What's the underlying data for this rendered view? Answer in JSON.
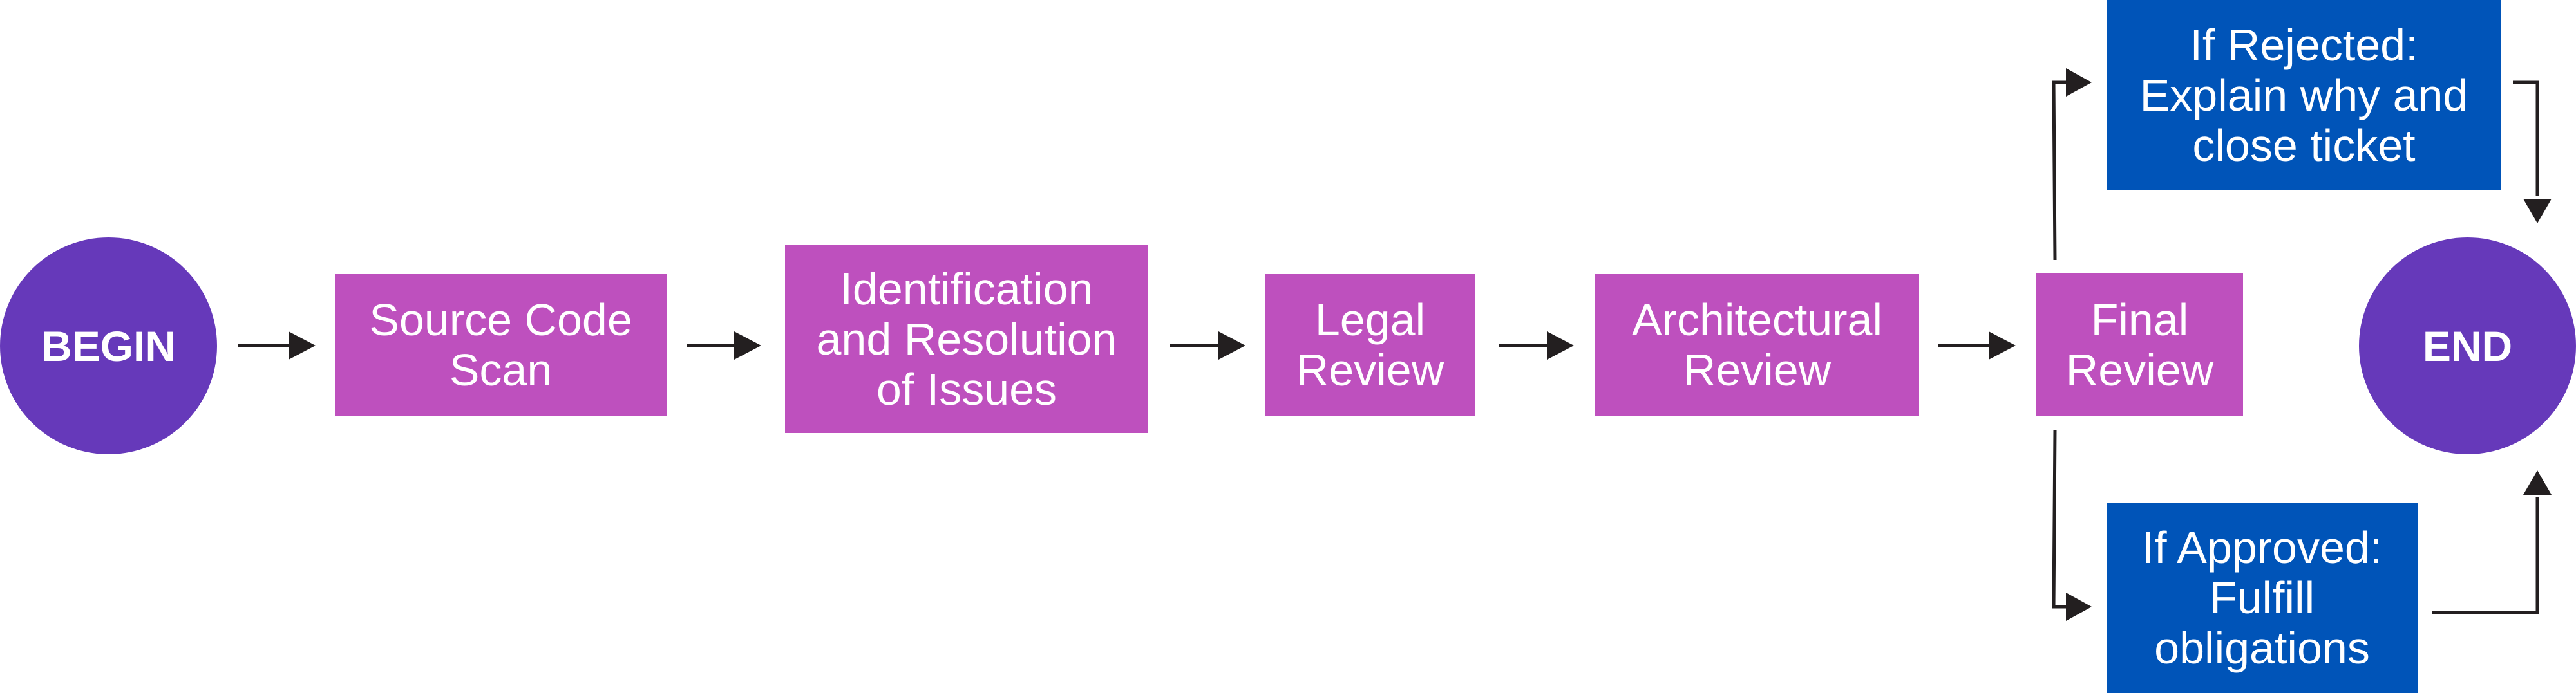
{
  "colors": {
    "terminal": "#6639BA",
    "step": "#BE50BE",
    "outcome": "#0054B8",
    "connector": "#231F20",
    "text": "#FFFFFF"
  },
  "nodes": {
    "begin": "BEGIN",
    "source_code_scan": "Source Code\nScan",
    "identification": "Identification\nand Resolution\nof Issues",
    "legal_review": "Legal\nReview",
    "architectural_review": "Architectural\nReview",
    "final_review": "Final\nReview",
    "rejected": "If Rejected:\nExplain why and\nclose ticket",
    "approved": "If Approved:\nFulfill\nobligations",
    "end": "END"
  },
  "edges": [
    {
      "from": "begin",
      "to": "source_code_scan"
    },
    {
      "from": "source_code_scan",
      "to": "identification"
    },
    {
      "from": "identification",
      "to": "legal_review"
    },
    {
      "from": "legal_review",
      "to": "architectural_review"
    },
    {
      "from": "architectural_review",
      "to": "final_review"
    },
    {
      "from": "final_review",
      "to": "rejected"
    },
    {
      "from": "final_review",
      "to": "approved"
    },
    {
      "from": "rejected",
      "to": "end"
    },
    {
      "from": "approved",
      "to": "end"
    }
  ]
}
